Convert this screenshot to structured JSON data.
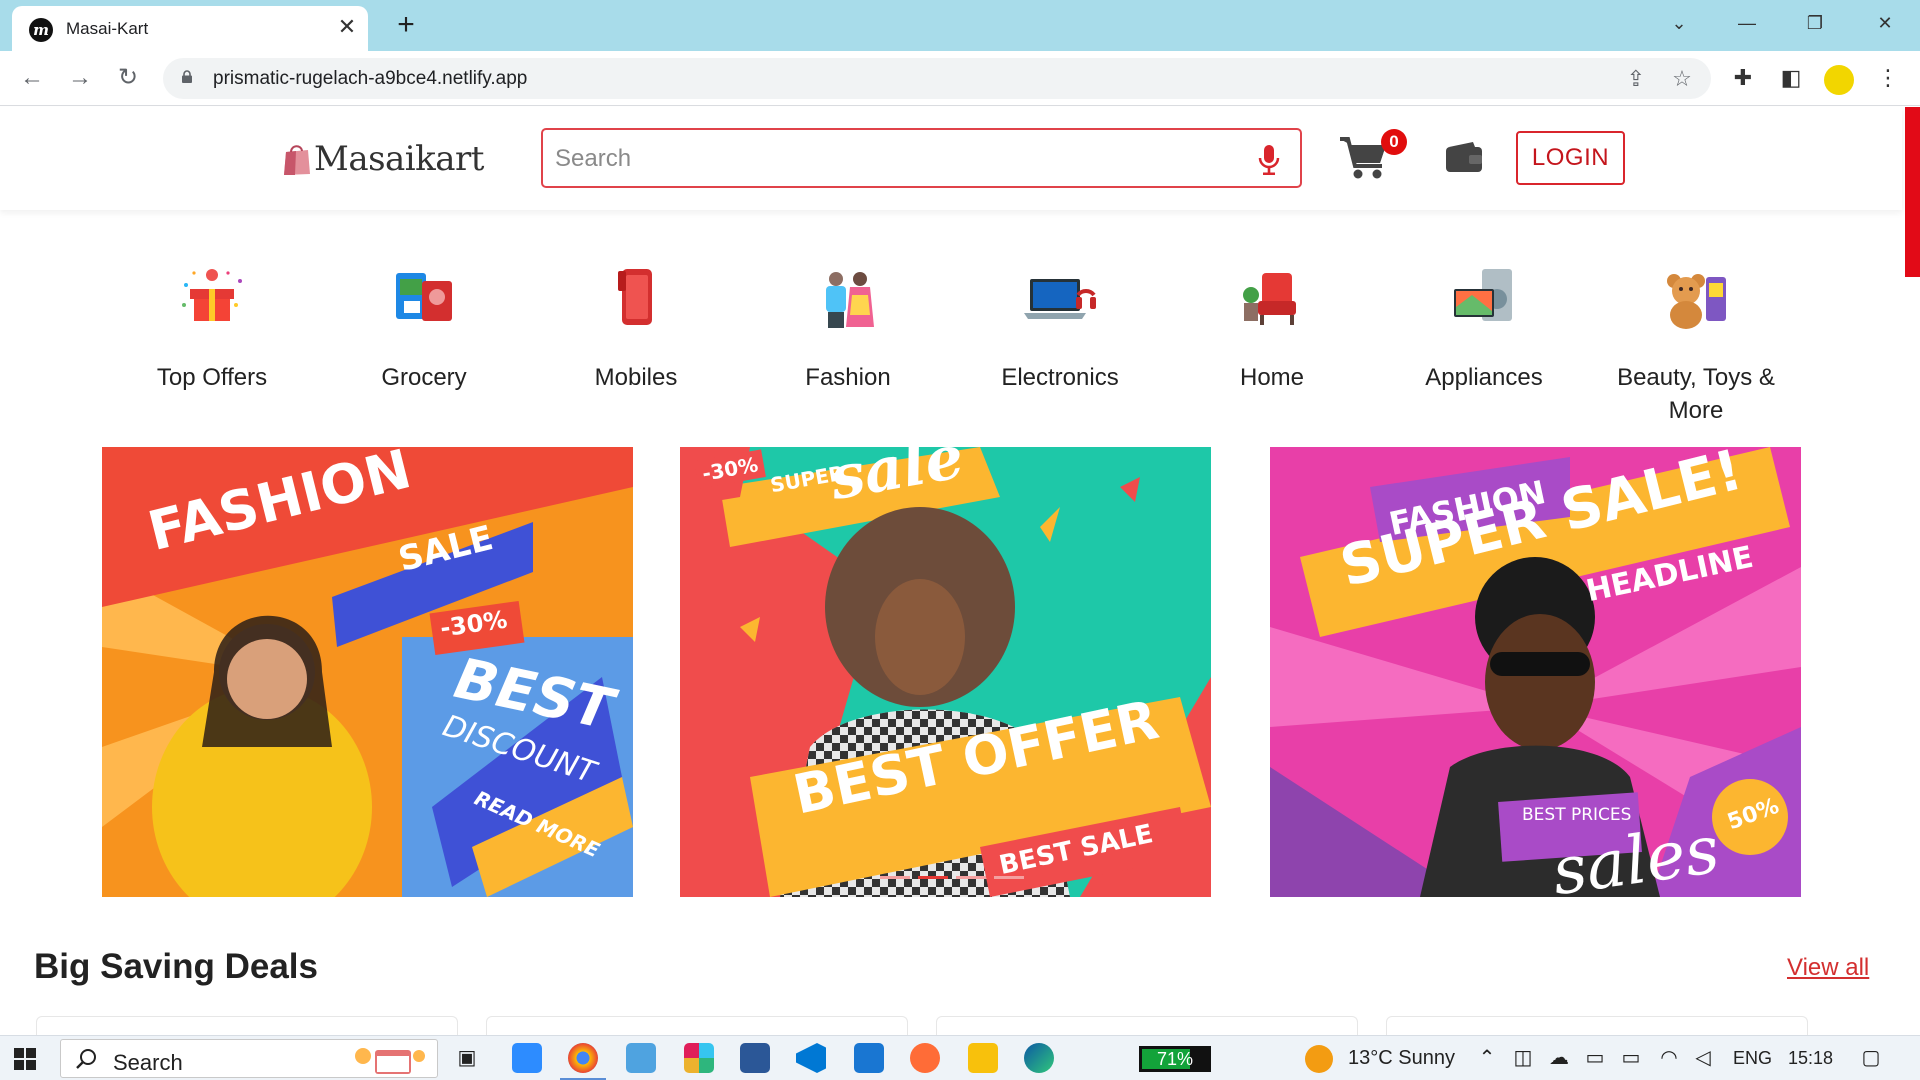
{
  "browser": {
    "tab_title": "Masai-Kart",
    "tab_favicon_letter": "m",
    "url": "prismatic-rugelach-a9bce4.netlify.app",
    "new_tab_symbol": "+",
    "close_symbol": "✕"
  },
  "header": {
    "logo_text": "Masaikart",
    "search_placeholder": "Search",
    "cart_count": "0",
    "login_label": "LOGIN"
  },
  "categories": [
    {
      "label": "Top Offers",
      "icon": "gift-icon"
    },
    {
      "label": "Grocery",
      "icon": "grocery-icon"
    },
    {
      "label": "Mobiles",
      "icon": "mobile-phone-icon"
    },
    {
      "label": "Fashion",
      "icon": "fashion-icon"
    },
    {
      "label": "Electronics",
      "icon": "laptop-icon"
    },
    {
      "label": "Home",
      "icon": "armchair-icon"
    },
    {
      "label": "Appliances",
      "icon": "appliances-icon"
    },
    {
      "label": "Beauty, Toys & More",
      "icon": "teddy-bear-icon"
    }
  ],
  "banners": [
    {
      "line1": "FASHION",
      "line2": "SALE",
      "badge": "-30%",
      "promo1": "BEST",
      "promo2": "DISCOUNT",
      "promo3": "READ MORE",
      "bg": "#f7931e",
      "accent": "#3f51d6"
    },
    {
      "badge": "-30%",
      "line1": "SUPER",
      "line2": "sale",
      "promo1": "BEST OFFER",
      "promo2": "BEST SALE",
      "bg": "#1ec8a8",
      "accent": "#f04c4c"
    },
    {
      "line1": "FASHION",
      "line2": "SUPER SALE!",
      "line3": "HEADLINE",
      "promo1": "BEST PRICES",
      "promo2": "sales",
      "badge": "50%",
      "bg": "#e83fa8",
      "accent": "#fcb630"
    }
  ],
  "deals": {
    "title": "Big Saving Deals",
    "view_all": "View all"
  },
  "taskbar": {
    "search_label": "Search",
    "battery": "71%",
    "weather": "13°C  Sunny",
    "language": "ENG",
    "time": "15:18"
  },
  "colors": {
    "brand_red": "#d9252c",
    "chrome_tabstrip": "#a8dcea"
  }
}
